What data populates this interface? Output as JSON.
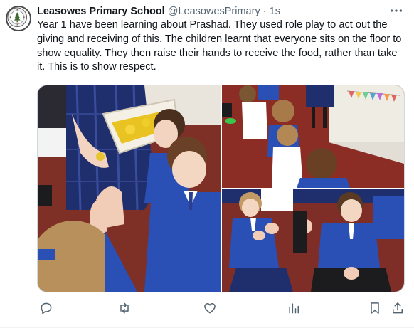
{
  "tweet": {
    "author_name": "Leasowes Primary School",
    "handle": "@LeasowesPrimary",
    "separator": "·",
    "time": "1s",
    "text": "Year 1 have been learning about Prashad. They used role play to act out the giving and receiving of this. The children learnt that everyone sits on the floor to show equality. They then raise their hands to receive the food, rather than take it. This is to show respect."
  },
  "icons": {
    "avatar": "school-crest-logo",
    "more": "more-horizontal-icon",
    "reply": "reply-icon",
    "retweet": "retweet-icon",
    "like": "heart-icon",
    "views": "views-chart-icon",
    "bookmark": "bookmark-icon",
    "share": "share-icon"
  },
  "media": {
    "photos": [
      "photo-hands-receiving-food",
      "photo-children-sitting-floor",
      "photo-children-raising-hands"
    ]
  },
  "colors": {
    "text": "#0f1419",
    "secondary": "#536471",
    "uniform_blue": "#2a4fb5",
    "carpet_red": "#8b2d25"
  }
}
